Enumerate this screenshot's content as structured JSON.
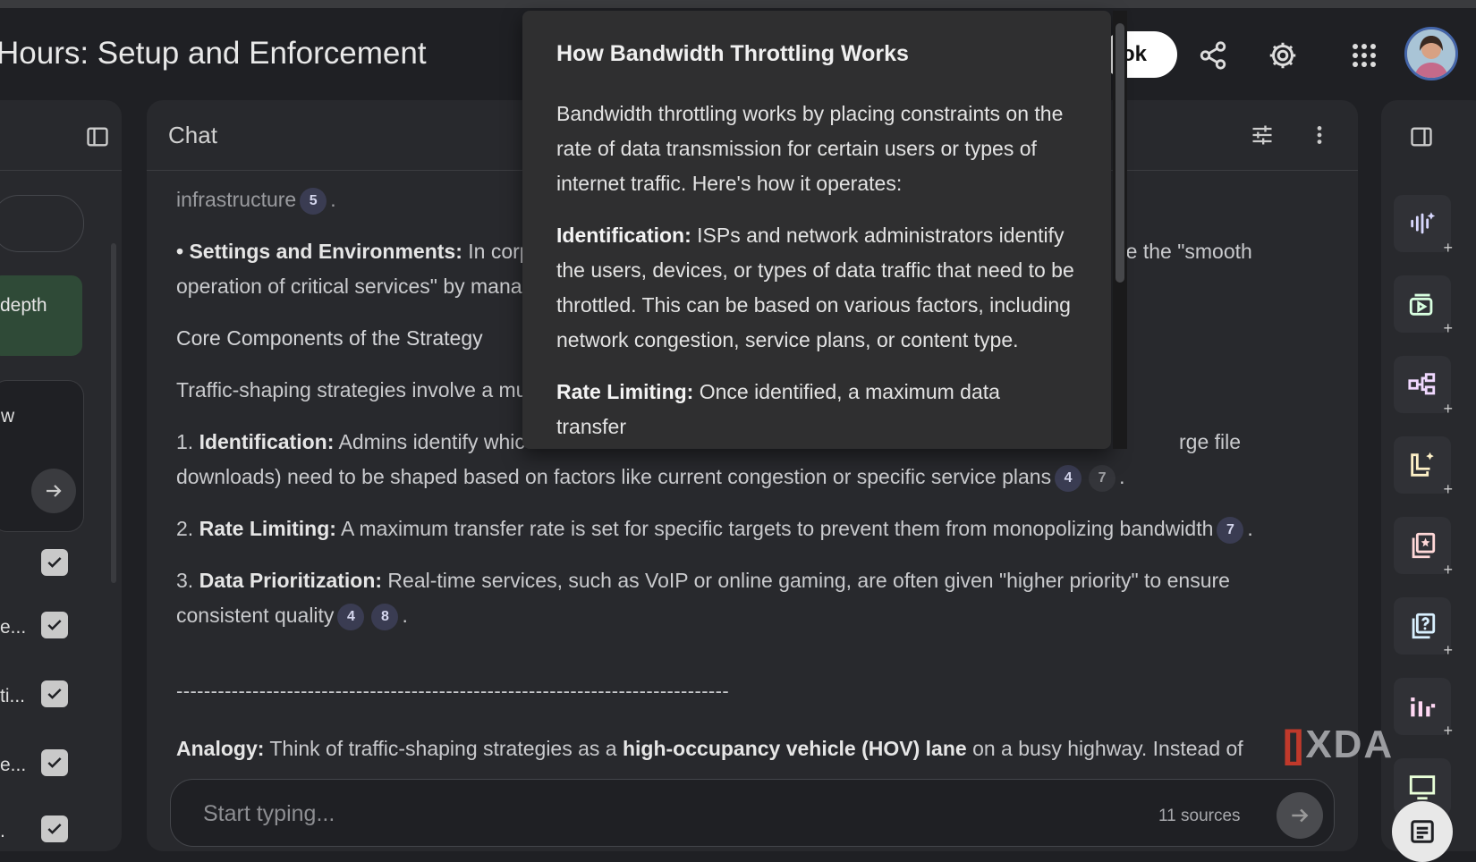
{
  "header": {
    "title": "Hours: Setup and Enforcement",
    "pill_button_label": "ok"
  },
  "left": {
    "selected_item": "depth",
    "card_text": "w",
    "source_rows": [
      {
        "label": ""
      },
      {
        "label": "e..."
      },
      {
        "label": "ti..."
      },
      {
        "label": "e..."
      },
      {
        "label": "."
      }
    ]
  },
  "chat": {
    "header_label": "Chat",
    "lines": {
      "l0": "infrastructure",
      "l1_bold": "• Settings and Environments:",
      "l1": " In corp",
      "l1_right": "re the \"smooth",
      "l2": "operation of critical services\" by mana",
      "l3": "Core Components of the Strategy",
      "l4": "Traffic-shaping strategies involve a mu",
      "l5_num": "1. ",
      "l5_bold": "Identification:",
      "l5": " Admins identify whic",
      "l5_right": "rge file",
      "l6": "downloads) need to be shaped based on factors like current congestion or specific service plans",
      "l7_num": "2. ",
      "l7_bold": "Rate Limiting:",
      "l7": " A maximum transfer rate is set for specific targets to prevent them from monopolizing bandwidth",
      "l8_num": "3. ",
      "l8_bold": "Data Prioritization:",
      "l8": " Real-time services, such as VoIP or online gaming, are often given \"higher priority\" to ensure",
      "l9": "consistent quality",
      "dashes": "--------------------------------------------------------------------------------",
      "l10_bold": "Analogy:",
      "l10a": " Think of traffic-shaping strategies as a ",
      "l10_bold2": "high-occupancy vehicle (HOV) lane",
      "l10b": " on a busy highway. Instead of"
    },
    "citations": {
      "c0": "5",
      "c6a": "4",
      "c6b": "7",
      "c7": "7",
      "c9a": "4",
      "c9b": "8"
    },
    "period": ".",
    "input": {
      "placeholder": "Start typing...",
      "sources": "11 sources"
    }
  },
  "popover": {
    "title": "How Bandwidth Throttling Works",
    "intro": "Bandwidth throttling works by placing constraints on the rate of data transmission for certain users or types of internet traffic. Here's how it operates:",
    "p1_bold": "Identification:",
    "p1": " ISPs and network administrators identify the users, devices, or types of data traffic that need to be throttled. This can be based on various factors, including network congestion, service plans, or content type.",
    "p2_bold": "Rate Limiting:",
    "p2": " Once identified, a maximum data transfer"
  },
  "watermark": {
    "text": "XDA"
  },
  "colors": {
    "background": "#1f2024",
    "panel": "#28292d",
    "popover": "#2f2f30",
    "selected": "#2f4a37",
    "citation": "#3a3c52"
  }
}
